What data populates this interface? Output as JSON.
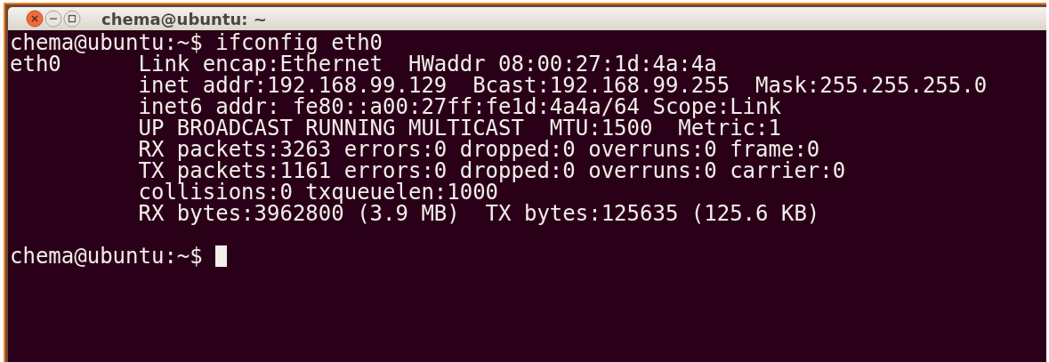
{
  "window": {
    "title": "chema@ubuntu: ~"
  },
  "terminal": {
    "lines": [
      {
        "kind": "text",
        "text": "chema@ubuntu:~$ ifconfig eth0"
      },
      {
        "kind": "text",
        "text": "eth0      Link encap:Ethernet  HWaddr 08:00:27:1d:4a:4a"
      },
      {
        "kind": "text",
        "text": "          inet addr:192.168.99.129  Bcast:192.168.99.255  Mask:255.255.255.0"
      },
      {
        "kind": "text",
        "text": "          inet6 addr: fe80::a00:27ff:fe1d:4a4a/64 Scope:Link"
      },
      {
        "kind": "text",
        "text": "          UP BROADCAST RUNNING MULTICAST  MTU:1500  Metric:1"
      },
      {
        "kind": "text",
        "text": "          RX packets:3263 errors:0 dropped:0 overruns:0 frame:0"
      },
      {
        "kind": "text",
        "text": "          TX packets:1161 errors:0 dropped:0 overruns:0 carrier:0"
      },
      {
        "kind": "text",
        "text": "          collisions:0 txqueuelen:1000"
      },
      {
        "kind": "text",
        "text": "          RX bytes:3962800 (3.9 MB)  TX bytes:125635 (125.6 KB)"
      },
      {
        "kind": "blank"
      },
      {
        "kind": "prompt",
        "text": "chema@ubuntu:~$ "
      }
    ]
  }
}
